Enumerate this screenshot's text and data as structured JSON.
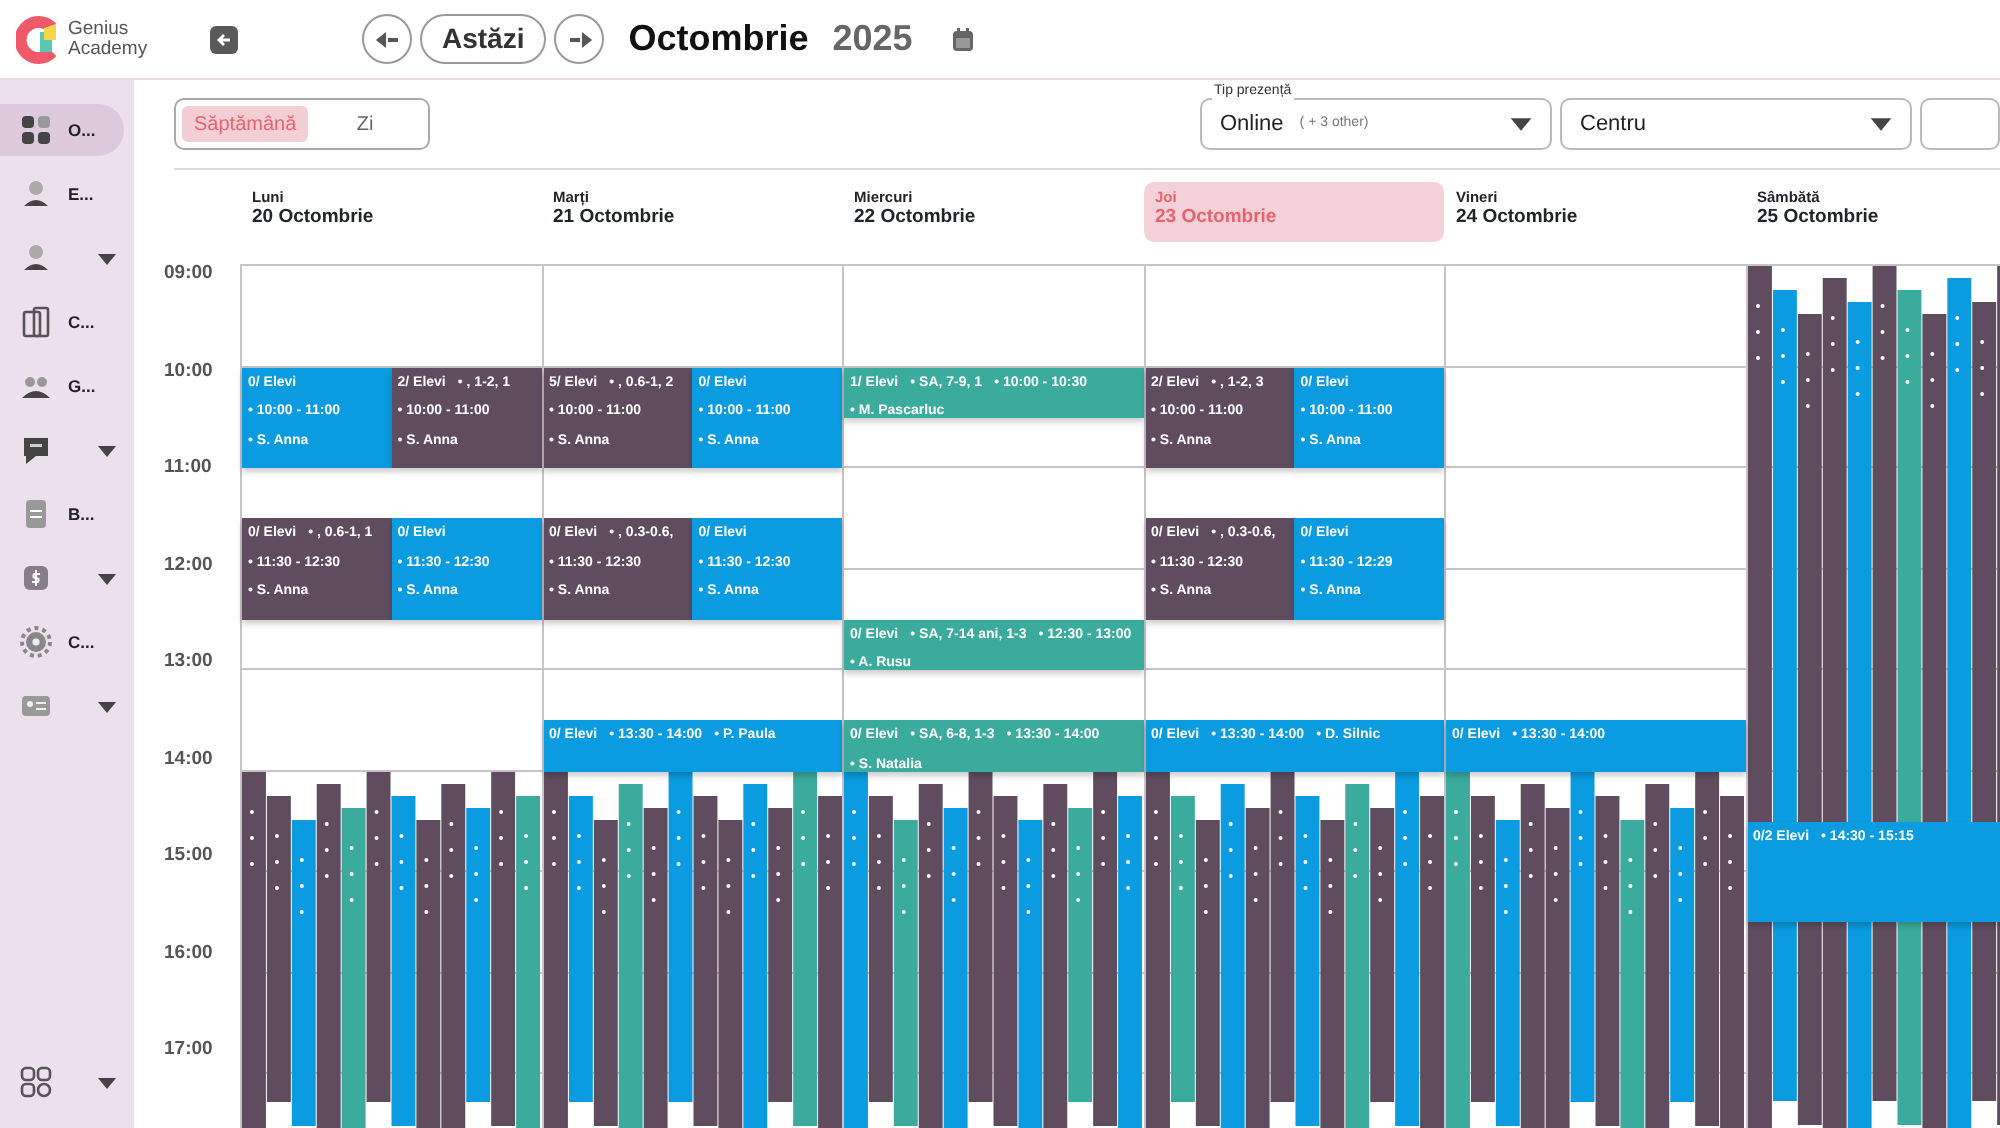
{
  "brand": {
    "line1": "Genius",
    "line2": "Academy"
  },
  "header": {
    "today": "Astăzi",
    "month": "Octombrie",
    "year": "2025"
  },
  "sidebar": {
    "items": [
      {
        "label": "O...",
        "selected": true,
        "caret": false
      },
      {
        "label": "E...",
        "selected": false,
        "caret": false
      },
      {
        "selected": false,
        "caret": true
      },
      {
        "label": "C...",
        "selected": false,
        "caret": false
      },
      {
        "label": "G...",
        "selected": false,
        "caret": false
      },
      {
        "selected": false,
        "caret": true
      },
      {
        "label": "B...",
        "selected": false,
        "caret": false
      },
      {
        "selected": false,
        "caret": true
      },
      {
        "label": "C...",
        "selected": false,
        "caret": false
      },
      {
        "selected": false,
        "caret": true
      }
    ],
    "footer": {
      "caret": true
    }
  },
  "view_tabs": [
    {
      "label": "Săptămână",
      "selected": true
    },
    {
      "label": "Zi",
      "selected": false
    }
  ],
  "filters": [
    {
      "label": "Tip prezență",
      "value": "Online",
      "extra": "( + 3 other)"
    },
    {
      "value": "Centru"
    }
  ],
  "hours": [
    "09:00",
    "10:00",
    "11:00",
    "12:00",
    "13:00",
    "14:00",
    "15:00",
    "16:00",
    "17:00"
  ],
  "days": [
    {
      "weekday": "Luni",
      "date": "20 Octombrie",
      "selected": false,
      "events": [
        {
          "color": "#0a9be0",
          "title": "0/ Elevi",
          "details": [
            "• 10:00 - 11:00",
            "• S. Anna"
          ]
        },
        {
          "color": "#5f4d5f",
          "title": "2/ Elevi",
          "details": [
            "• , 1-2, 1",
            "• 10:00 - 11:00",
            "• S. Anna"
          ]
        },
        {
          "color": "#5f4d5f",
          "title": "0/ Elevi",
          "details": [
            "• , 0.6-1, 1",
            "• 11:30 - 12:30",
            "• S. Anna"
          ]
        },
        {
          "color": "#0a9be0",
          "title": "0/ Elevi",
          "details": [
            "• 11:30 - 12:30",
            "• S. Anna"
          ]
        }
      ]
    },
    {
      "weekday": "Marți",
      "date": "21 Octombrie",
      "selected": false,
      "events": [
        {
          "color": "#5f4d5f",
          "title": "5/ Elevi",
          "details": [
            "• , 0.6-1, 2",
            "• 10:00 - 11:00",
            "• S. Anna"
          ]
        },
        {
          "color": "#0a9be0",
          "title": "0/ Elevi",
          "details": [
            "• 10:00 - 11:00",
            "• S. Anna"
          ]
        },
        {
          "color": "#5f4d5f",
          "title": "0/ Elevi",
          "details": [
            "• , 0.3-0.6,",
            "• 11:30 - 12:30",
            "• S. Anna"
          ]
        },
        {
          "color": "#0a9be0",
          "title": "0/ Elevi",
          "details": [
            "• 11:30 - 12:30",
            "• S. Anna"
          ]
        },
        {
          "color": "#0a9be0",
          "title": "0/ Elevi",
          "details": [
            "• 13:30 - 14:00",
            "• P. Paula"
          ]
        }
      ]
    },
    {
      "weekday": "Miercuri",
      "date": "22 Octombrie",
      "selected": false,
      "events": [
        {
          "color": "#3aab9c",
          "title": "1/ Elevi",
          "details": [
            "• SA, 7-9, 1",
            "• 10:00 - 10:30",
            "• M. Pascarluc"
          ]
        },
        {
          "color": "#3aab9c",
          "title": "0/ Elevi",
          "details": [
            "• SA, 7-14 ani, 1-3",
            "• 12:30 - 13:00",
            "• A. Rusu"
          ]
        },
        {
          "color": "#3aab9c",
          "title": "0/ Elevi",
          "details": [
            "• SA, 6-8, 1-3",
            "• 13:30 - 14:00",
            "• S. Natalia"
          ]
        }
      ]
    },
    {
      "weekday": "Joi",
      "date": "23 Octombrie",
      "selected": true,
      "events": [
        {
          "color": "#5f4d5f",
          "title": "2/ Elevi",
          "details": [
            "• , 1-2, 3",
            "• 10:00 - 11:00",
            "• S. Anna"
          ]
        },
        {
          "color": "#0a9be0",
          "title": "0/ Elevi",
          "details": [
            "• 10:00 - 11:00",
            "• S. Anna"
          ]
        },
        {
          "color": "#5f4d5f",
          "title": "0/ Elevi",
          "details": [
            "• , 0.3-0.6,",
            "• 11:30 - 12:30",
            "• S. Anna"
          ]
        },
        {
          "color": "#0a9be0",
          "title": "0/ Elevi",
          "details": [
            "• 11:30 - 12:29",
            "• S. Anna"
          ]
        },
        {
          "color": "#0a9be0",
          "title": "0/ Elevi",
          "details": [
            "• 13:30 - 14:00",
            "• D. Silnic"
          ]
        }
      ]
    },
    {
      "weekday": "Vineri",
      "date": "24 Octombrie",
      "selected": false,
      "events": [
        {
          "color": "#0a9be0",
          "title": "0/ Elevi",
          "details": [
            "• 13:30 - 14:00"
          ]
        }
      ]
    },
    {
      "weekday": "Sâmbătă",
      "date": "25 Octombrie",
      "selected": false,
      "events": [
        {
          "color": "#0a9be0",
          "title": "0/2 Elevi",
          "details": [
            "• 14:30 - 15:15"
          ]
        }
      ]
    }
  ]
}
